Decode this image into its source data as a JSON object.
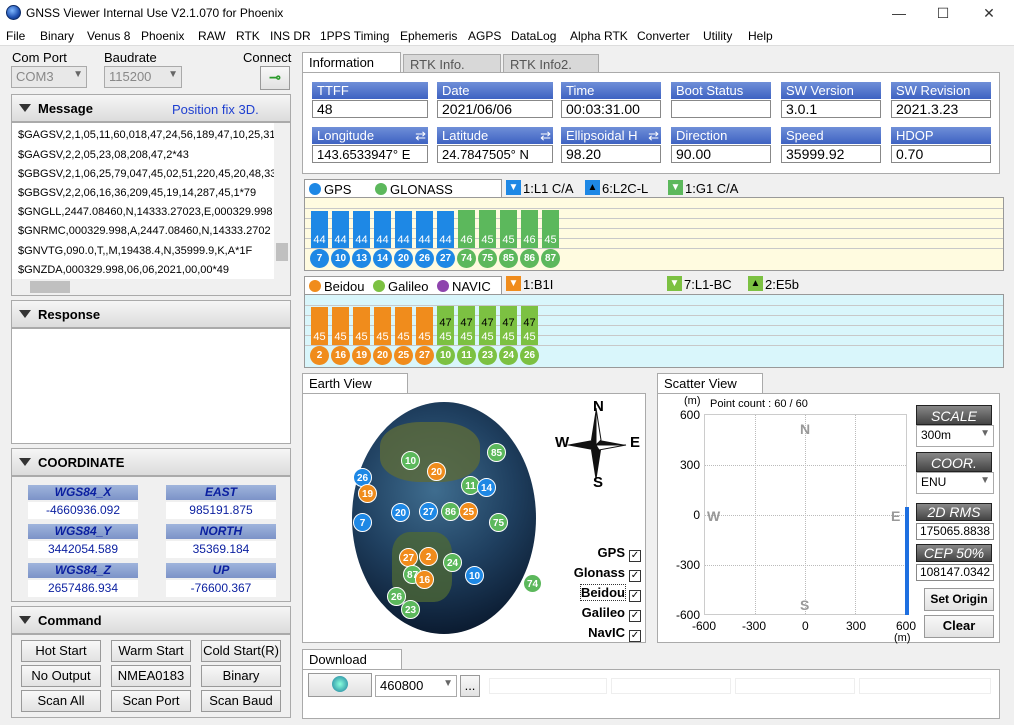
{
  "window": {
    "title": "GNSS Viewer Internal Use V2.1.070 for Phoenix",
    "minimize": "—",
    "maximize": "☐",
    "close": "✕"
  },
  "menu": [
    "File",
    "Binary",
    "Venus 8",
    "Phoenix",
    "RAW",
    "RTK",
    "INS DR",
    "1PPS Timing",
    "Ephemeris",
    "AGPS",
    "DataLog",
    "Alpha RTK",
    "Converter",
    "Utility",
    "Help"
  ],
  "conn": {
    "com_port_label": "Com Port",
    "com_port": "COM3",
    "baud_label": "Baudrate",
    "baud": "115200",
    "connect_label": "Connect"
  },
  "message": {
    "title": "Message",
    "status": "Position fix 3D.",
    "lines": [
      "$GAGSV,2,1,05,11,60,018,47,24,56,189,47,10,25,31",
      "$GAGSV,2,2,05,23,08,208,47,2*43",
      "$GBGSV,2,1,06,25,79,047,45,02,51,220,45,20,48,33",
      "$GBGSV,2,2,06,16,36,209,45,19,14,287,45,1*79",
      "$GNGLL,2447.08460,N,14333.27023,E,000329.998",
      "$GNRMC,000329.998,A,2447.08460,N,14333.2702",
      "$GNVTG,090.0,T,,M,19438.4,N,35999.9,K,A*1F",
      "$GNZDA,000329.998,06,06,2021,00,00*49"
    ]
  },
  "response": {
    "title": "Response"
  },
  "coordinate": {
    "title": "COORDINATE",
    "x_label": "WGS84_X",
    "x": "-4660936.092",
    "east_label": "EAST",
    "east": "985191.875",
    "y_label": "WGS84_Y",
    "y": "3442054.589",
    "north_label": "NORTH",
    "north": "35369.184",
    "z_label": "WGS84_Z",
    "z": "2657486.934",
    "up_label": "UP",
    "up": "-76600.367"
  },
  "command": {
    "title": "Command",
    "buttons": [
      "Hot Start",
      "Warm Start",
      "Cold Start(R)",
      "No Output",
      "NMEA0183",
      "Binary",
      "Scan All",
      "Scan Port",
      "Scan Baud"
    ]
  },
  "tabs": [
    "Information",
    "RTK Info.",
    "RTK Info2."
  ],
  "info": {
    "ttff_label": "TTFF",
    "ttff": "48",
    "date_label": "Date",
    "date": "2021/06/06",
    "time_label": "Time",
    "time": "00:03:31.00",
    "boot_label": "Boot Status",
    "boot": "",
    "swver_label": "SW Version",
    "swver": "3.0.1",
    "swrev_label": "SW Revision",
    "swrev": "2021.3.23",
    "lon_label": "Longitude",
    "lon": "143.6533947° E",
    "lat_label": "Latitude",
    "lat": "24.7847505° N",
    "alt_label": "Ellipsoidal H",
    "alt": "98.20",
    "dir_label": "Direction",
    "dir": "90.00",
    "speed_label": "Speed",
    "speed": "35999.92",
    "hdop_label": "HDOP",
    "hdop": "0.70"
  },
  "gps_chart": {
    "legend": [
      "GPS",
      "GLONASS"
    ],
    "signals": [
      "1:L1 C/A",
      "6:L2C-L",
      "1:G1 C/A"
    ],
    "sats": [
      {
        "prn": "7",
        "snr": 44,
        "sys": "gps"
      },
      {
        "prn": "10",
        "snr": 44,
        "sys": "gps"
      },
      {
        "prn": "13",
        "snr": 44,
        "sys": "gps"
      },
      {
        "prn": "14",
        "snr": 44,
        "sys": "gps"
      },
      {
        "prn": "20",
        "snr": 44,
        "sys": "gps"
      },
      {
        "prn": "26",
        "snr": 44,
        "sys": "gps"
      },
      {
        "prn": "27",
        "snr": 44,
        "sys": "gps"
      },
      {
        "prn": "74",
        "snr": 46,
        "sys": "glo"
      },
      {
        "prn": "75",
        "snr": 45,
        "sys": "glo"
      },
      {
        "prn": "85",
        "snr": 45,
        "sys": "glo"
      },
      {
        "prn": "86",
        "snr": 46,
        "sys": "glo"
      },
      {
        "prn": "87",
        "snr": 45,
        "sys": "glo"
      }
    ]
  },
  "bd_chart": {
    "legend": [
      "Beidou",
      "Galileo",
      "NAVIC"
    ],
    "signals": [
      "1:B1I",
      "7:L1-BC",
      "2:E5b"
    ],
    "sats": [
      {
        "prn": "2",
        "snr": 45,
        "sys": "bd"
      },
      {
        "prn": "16",
        "snr": 45,
        "sys": "bd"
      },
      {
        "prn": "19",
        "snr": 45,
        "sys": "bd"
      },
      {
        "prn": "20",
        "snr": 45,
        "sys": "bd"
      },
      {
        "prn": "25",
        "snr": 45,
        "sys": "bd"
      },
      {
        "prn": "27",
        "snr": 45,
        "sys": "bd"
      },
      {
        "prn": "10",
        "snr": 47,
        "sys": "gal",
        "sub": "45"
      },
      {
        "prn": "11",
        "snr": 47,
        "sys": "gal",
        "sub": "45"
      },
      {
        "prn": "23",
        "snr": 47,
        "sys": "gal",
        "sub": "45"
      },
      {
        "prn": "24",
        "snr": 47,
        "sys": "gal",
        "sub": "45"
      },
      {
        "prn": "26",
        "snr": 47,
        "sys": "gal",
        "sub": "45"
      }
    ]
  },
  "earth": {
    "tab": "Earth View",
    "compass": {
      "n": "N",
      "s": "S",
      "e": "E",
      "w": "W"
    },
    "sats": [
      {
        "prn": "10",
        "sys": "glo"
      },
      {
        "prn": "85",
        "sys": "glo"
      },
      {
        "prn": "20",
        "sys": "bd"
      },
      {
        "prn": "26",
        "sys": "gps"
      },
      {
        "prn": "19",
        "sys": "bd"
      },
      {
        "prn": "11",
        "sys": "glo"
      },
      {
        "prn": "14",
        "sys": "gps"
      },
      {
        "prn": "20",
        "sys": "gps"
      },
      {
        "prn": "27",
        "sys": "gps"
      },
      {
        "prn": "86",
        "sys": "glo"
      },
      {
        "prn": "25",
        "sys": "bd"
      },
      {
        "prn": "75",
        "sys": "glo"
      },
      {
        "prn": "7",
        "sys": "gps"
      },
      {
        "prn": "27",
        "sys": "bd"
      },
      {
        "prn": "2",
        "sys": "bd"
      },
      {
        "prn": "24",
        "sys": "glo"
      },
      {
        "prn": "87",
        "sys": "glo"
      },
      {
        "prn": "16",
        "sys": "bd"
      },
      {
        "prn": "10",
        "sys": "gps"
      },
      {
        "prn": "74",
        "sys": "glo"
      },
      {
        "prn": "26",
        "sys": "glo"
      },
      {
        "prn": "23",
        "sys": "glo"
      }
    ],
    "filters": [
      "GPS",
      "Glonass",
      "Beidou",
      "Galileo",
      "NavIC"
    ]
  },
  "scatter": {
    "tab": "Scatter View",
    "unit": "(m)",
    "point_count": "Point count : 60 / 60",
    "y_ticks": [
      "600",
      "300",
      "0",
      "-300",
      "-600"
    ],
    "x_ticks": [
      "-600",
      "-300",
      "0",
      "300",
      "600"
    ],
    "compass": {
      "n": "N",
      "s": "S",
      "e": "E",
      "w": "W"
    },
    "scale_label": "SCALE",
    "scale": "300m",
    "coor_label": "COOR.",
    "coor": "ENU",
    "rms_label": "2D RMS",
    "rms": "175065.8838",
    "cep_label": "CEP 50%",
    "cep": "108147.0342",
    "set_origin": "Set Origin",
    "clear": "Clear"
  },
  "download": {
    "tab": "Download",
    "baud": "460800",
    "browse": "..."
  },
  "colors": {
    "gps": "#1e88e5",
    "glo": "#5cb85c",
    "bd": "#f08c1c",
    "gal": "#7cc142",
    "navic": "#8e44ad"
  }
}
